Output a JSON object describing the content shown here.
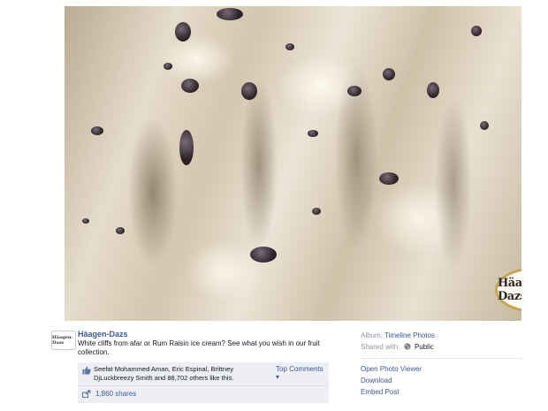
{
  "post": {
    "page_name": "Häagen-Dazs",
    "caption": "White cliffs from afar or Rum Raisin ice cream? See what you wish in our fruit collection.",
    "photo_logo_text": "Häagen-Dazs",
    "avatar_text": "Häagen-Dazs"
  },
  "likes": {
    "text": "Seefat Mohammed Aman, Eric Espinal, Brittney DjLuckbreezy Smith and 88,702 others like this.",
    "top_comments": "Top Comments ▾",
    "shares": "1,860 shares"
  },
  "sidebar": {
    "album_label": "Album:",
    "album_value": "Timeline Photos",
    "shared_label": "Shared with:",
    "shared_value": "Public",
    "actions": [
      "Open Photo Viewer",
      "Download",
      "Embed Post"
    ]
  },
  "colors": {
    "link": "#3b5998",
    "muted": "#9197a3",
    "likebox_bg": "#edeff4"
  },
  "icons": [
    "thumbs-up-icon",
    "share-icon",
    "globe-icon"
  ]
}
